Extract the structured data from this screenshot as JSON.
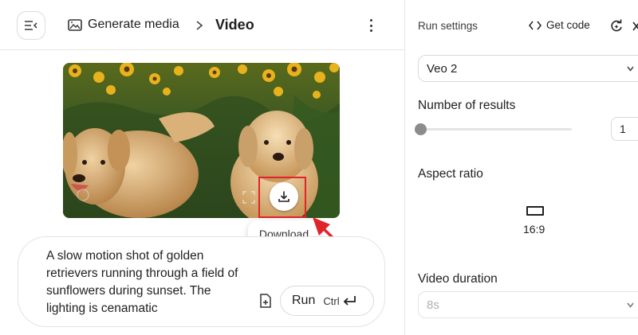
{
  "header": {
    "breadcrumb_parent": "Generate media",
    "breadcrumb_current": "Video"
  },
  "video": {
    "tooltip": "Download"
  },
  "prompt": {
    "text": "A slow motion shot of golden retrievers running through a field of sunflowers during sunset. The lighting is cenamatic",
    "run_label": "Run",
    "run_shortcut": "Ctrl"
  },
  "settings": {
    "title": "Run settings",
    "get_code_label": "Get code",
    "model": "Veo 2",
    "results_label": "Number of results",
    "results_value": "1",
    "results_slider_fraction": 0.0,
    "aspect_label": "Aspect ratio",
    "aspect_value": "16:9",
    "duration_label": "Video duration",
    "duration_value": "8s"
  },
  "colors": {
    "highlight": "#e0242b",
    "slider_thumb": "#8c8c8c"
  },
  "icons": [
    "menu-collapse-icon",
    "image-spark-icon",
    "chevron-right-icon",
    "more-vert-icon",
    "expand-icon",
    "download-icon",
    "add-file-icon",
    "enter-icon",
    "code-icon",
    "reset-icon",
    "close-icon",
    "chevron-down-icon"
  ]
}
